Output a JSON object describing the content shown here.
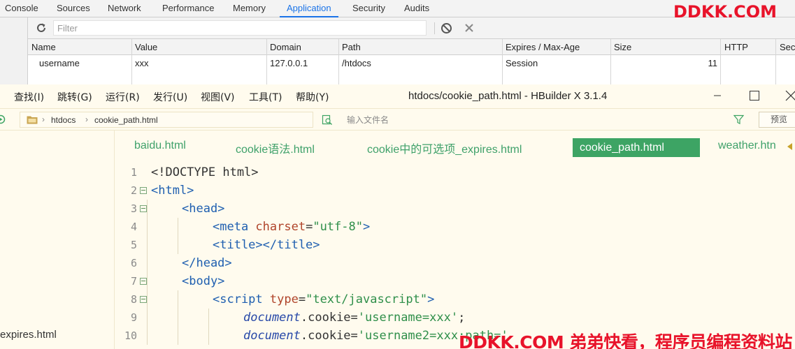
{
  "devtools": {
    "tabs": [
      "Console",
      "Sources",
      "Network",
      "Performance",
      "Memory",
      "Application",
      "Security",
      "Audits"
    ],
    "active_tab": "Application",
    "accent_color": "#1a73e8",
    "brand": "DDKK.COM",
    "filter_placeholder": "Filter",
    "columns": [
      "Name",
      "Value",
      "Domain",
      "Path",
      "Expires / Max-Age",
      "Size",
      "HTTP",
      "Secu"
    ],
    "rows": [
      {
        "name": "username",
        "value": "xxx",
        "domain": "127.0.0.1",
        "path": "/htdocs",
        "expires": "Session",
        "size": "11"
      }
    ]
  },
  "hbuilder": {
    "menu": [
      "查找(I)",
      "跳转(G)",
      "运行(R)",
      "发行(U)",
      "视图(V)",
      "工具(T)",
      "帮助(Y)"
    ],
    "window_title": "htdocs/cookie_path.html - HBuilder X 3.1.4",
    "breadcrumb": [
      "htdocs",
      "cookie_path.html"
    ],
    "file_search_placeholder": "输入文件名",
    "preview_label": "预览",
    "sidebar_file": "expires.html",
    "tabs": [
      "baidu.html",
      "cookie语法.html",
      "cookie中的可选项_expires.html",
      "cookie_path.html",
      "weather.htn"
    ],
    "active_tab": "cookie_path.html",
    "accent_color": "#3da464",
    "code_lines": [
      {
        "n": "1",
        "fold": false,
        "indent": 0,
        "tokens": [
          {
            "c": "k-plain",
            "t": "<!DOCTYPE html>"
          }
        ]
      },
      {
        "n": "2",
        "fold": true,
        "indent": 0,
        "tokens": [
          {
            "c": "k-tag",
            "t": "<html>"
          }
        ]
      },
      {
        "n": "3",
        "fold": true,
        "indent": 1,
        "tokens": [
          {
            "c": "k-tag",
            "t": "<head>"
          }
        ]
      },
      {
        "n": "4",
        "fold": false,
        "indent": 2,
        "tokens": [
          {
            "c": "k-tag",
            "t": "<meta "
          },
          {
            "c": "k-attr",
            "t": "charset"
          },
          {
            "c": "k-plain",
            "t": "="
          },
          {
            "c": "k-str",
            "t": "\"utf-8\""
          },
          {
            "c": "k-tag",
            "t": ">"
          }
        ]
      },
      {
        "n": "5",
        "fold": false,
        "indent": 2,
        "tokens": [
          {
            "c": "k-tag",
            "t": "<title></title>"
          }
        ]
      },
      {
        "n": "6",
        "fold": false,
        "indent": 1,
        "tokens": [
          {
            "c": "k-tag",
            "t": "</head>"
          }
        ]
      },
      {
        "n": "7",
        "fold": true,
        "indent": 1,
        "tokens": [
          {
            "c": "k-tag",
            "t": "<body>"
          }
        ]
      },
      {
        "n": "8",
        "fold": true,
        "indent": 2,
        "tokens": [
          {
            "c": "k-tag",
            "t": "<script "
          },
          {
            "c": "k-attr",
            "t": "type"
          },
          {
            "c": "k-plain",
            "t": "="
          },
          {
            "c": "k-str",
            "t": "\"text/javascript\""
          },
          {
            "c": "k-tag",
            "t": ">"
          }
        ]
      },
      {
        "n": "9",
        "fold": false,
        "indent": 3,
        "tokens": [
          {
            "c": "k-obj",
            "t": "document"
          },
          {
            "c": "k-plain",
            "t": ".cookie="
          },
          {
            "c": "k-str",
            "t": "'username=xxx'"
          },
          {
            "c": "k-plain",
            "t": ";"
          }
        ]
      },
      {
        "n": "10",
        "fold": false,
        "indent": 3,
        "tokens": [
          {
            "c": "k-obj",
            "t": "document"
          },
          {
            "c": "k-plain",
            "t": ".cookie="
          },
          {
            "c": "k-str",
            "t": "'username2=xxx;path='"
          }
        ]
      }
    ]
  },
  "watermark": "DDKK.COM 弟弟快看，程序员编程资料站"
}
